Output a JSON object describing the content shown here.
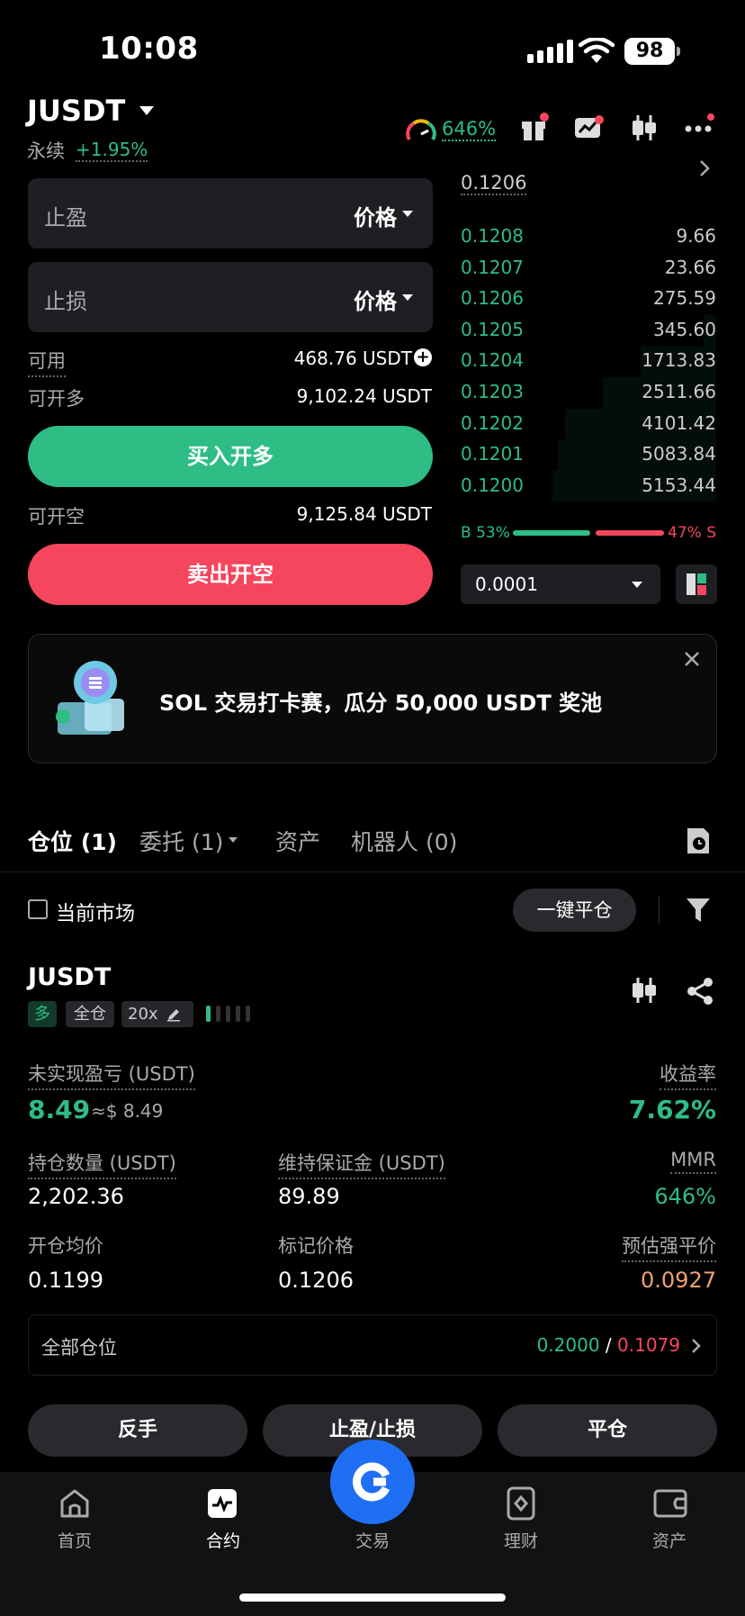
{
  "status_bar": {
    "time": "10:08",
    "battery": "98"
  },
  "header": {
    "pair": "JUSDT",
    "contract_type": "永续",
    "change": "+1.95%",
    "mmr_gauge": "646%"
  },
  "order_form": {
    "take_profit": {
      "label": "止盈",
      "select": "价格"
    },
    "stop_loss": {
      "label": "止损",
      "select": "价格"
    },
    "available_label": "可用",
    "available_value": "468.76 USDT",
    "can_long_label": "可开多",
    "can_long_value": "9,102.24 USDT",
    "buy_long": "买入开多",
    "can_short_label": "可开空",
    "can_short_value": "9,125.84 USDT",
    "sell_short": "卖出开空"
  },
  "orderbook": {
    "last_price": "0.1206",
    "rows": [
      {
        "price": "0.1208",
        "size": "9.66",
        "depth": 0.0
      },
      {
        "price": "0.1207",
        "size": "23.66",
        "depth": 0.0
      },
      {
        "price": "0.1206",
        "size": "275.59",
        "depth": 0.0
      },
      {
        "price": "0.1205",
        "size": "345.60",
        "depth": 0.05
      },
      {
        "price": "0.1204",
        "size": "1713.83",
        "depth": 0.3
      },
      {
        "price": "0.1203",
        "size": "2511.66",
        "depth": 0.45
      },
      {
        "price": "0.1202",
        "size": "4101.42",
        "depth": 0.6
      },
      {
        "price": "0.1201",
        "size": "5083.84",
        "depth": 0.63
      },
      {
        "price": "0.1200",
        "size": "5153.44",
        "depth": 0.65
      }
    ],
    "buy_ratio": "B 53%",
    "sell_ratio": "47% S",
    "buy_ratio_value": 53,
    "tick_size": "0.0001"
  },
  "banner": {
    "text": "SOL 交易打卡赛，瓜分 50,000 USDT 奖池"
  },
  "tabs": [
    {
      "label": "仓位 (1)"
    },
    {
      "label": "委托 (1)"
    },
    {
      "label": "资产"
    },
    {
      "label": "机器人 (0)"
    }
  ],
  "filters": {
    "current_market": "当前市场",
    "close_all": "一键平仓"
  },
  "position": {
    "symbol": "JUSDT",
    "side": "多",
    "margin_mode": "全仓",
    "leverage": "20x",
    "unrealized_pnl_label": "未实现盈亏 (USDT)",
    "unrealized_pnl": "8.49",
    "unrealized_pnl_usd": "≈$ 8.49",
    "roi_label": "收益率",
    "roi": "7.62%",
    "size_label": "持仓数量 (USDT)",
    "size": "2,202.36",
    "maint_margin_label": "维持保证金 (USDT)",
    "maint_margin": "89.89",
    "mmr_label": "MMR",
    "mmr": "646%",
    "entry_label": "开仓均价",
    "entry": "0.1199",
    "mark_label": "标记价格",
    "mark": "0.1206",
    "liq_label": "预估强平价",
    "liq": "0.0927",
    "all_positions_label": "全部仓位",
    "all_tp": "0.2000",
    "all_sep": "/",
    "all_sl": "0.1079"
  },
  "actions": {
    "reverse": "反手",
    "tpsl": "止盈/止损",
    "close": "平仓"
  },
  "nav": [
    {
      "label": "首页",
      "icon": "home-icon"
    },
    {
      "label": "合约",
      "icon": "futures-icon"
    },
    {
      "label": "交易",
      "icon": "trade-icon"
    },
    {
      "label": "理财",
      "icon": "earn-icon"
    },
    {
      "label": "资产",
      "icon": "wallet-icon"
    }
  ]
}
